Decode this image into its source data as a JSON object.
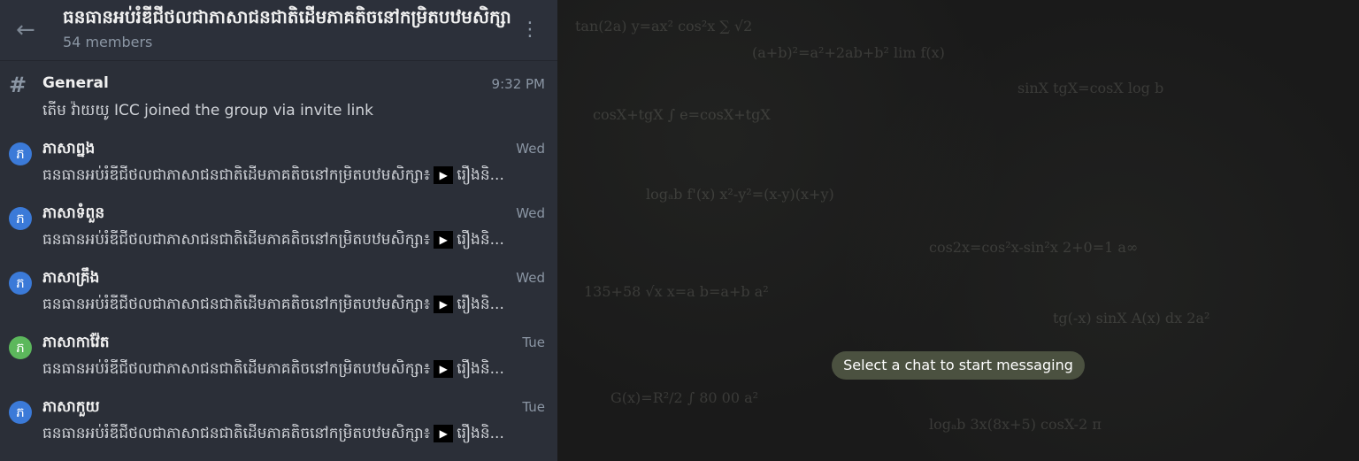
{
  "header": {
    "title": "ធនធានអប់រំឌីជីថលជាភាសាជនជាតិដើមភាគតិចនៅកម្រិតបឋមសិក្សា",
    "subtitle": "54 members"
  },
  "chats": [
    {
      "icon": "hash-icon",
      "title": "General",
      "time": "9:32 PM",
      "preview": "តើម វ៉ាយយូ ICC joined the group via invite link",
      "avatar_color": "#8b96a4"
    },
    {
      "icon": "avatar",
      "title": "ភាសាព្នង",
      "time": "Wed",
      "preview": "ធនធានអប់រំឌីជីថលជាភាសាជនជាតិដើមភាគតិចនៅកម្រិតបឋមសិក្សា៖",
      "preview_tail": "រឿងនិ...",
      "avatar_letter": "ភ",
      "avatar_color": "#3b7ad8"
    },
    {
      "icon": "avatar",
      "title": "ភាសាទំពួន",
      "time": "Wed",
      "preview": "ធនធានអប់រំឌីជីថលជាភាសាជនជាតិដើមភាគតិចនៅកម្រិតបឋមសិក្សា៖",
      "preview_tail": "រឿងនិ...",
      "avatar_letter": "ភ",
      "avatar_color": "#3b7ad8"
    },
    {
      "icon": "avatar",
      "title": "ភាសាគ្រឹង",
      "time": "Wed",
      "preview": "ធនធានអប់រំឌីជីថលជាភាសាជនជាតិដើមភាគតិចនៅកម្រិតបឋមសិក្សា៖",
      "preview_tail": "រឿងនិ...",
      "avatar_letter": "ភ",
      "avatar_color": "#3b7ad8"
    },
    {
      "icon": "avatar",
      "title": "ភាសាកាវ៉ែត",
      "time": "Tue",
      "preview": "ធនធានអប់រំឌីជីថលជាភាសាជនជាតិដើមភាគតិចនៅកម្រិតបឋមសិក្សា៖",
      "preview_tail": "រឿងនិ...",
      "avatar_letter": "ភ",
      "avatar_color": "#5cb85c"
    },
    {
      "icon": "avatar",
      "title": "ភាសាកួយ",
      "time": "Tue",
      "preview": "ធនធានអប់រំឌីជីថលជាភាសាជនជាតិដើមភាគតិចនៅកម្រិតបឋមសិក្សា៖",
      "preview_tail": "រឿងនិ...",
      "avatar_letter": "ភ",
      "avatar_color": "#3b7ad8"
    }
  ],
  "right_panel": {
    "placeholder": "Select a chat to start messaging"
  }
}
